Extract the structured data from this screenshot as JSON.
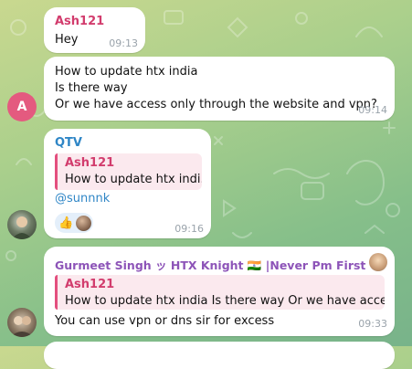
{
  "messages": [
    {
      "sender": "Ash121",
      "sender_color": "#d23c6d",
      "text": "Hey",
      "time": "09:13"
    },
    {
      "lines": [
        "How to update htx india",
        "Is there way",
        "Or we have access only through the website and vpn?"
      ],
      "time": "09:14",
      "avatar_letter": "A",
      "avatar_color": "#e45a7f"
    },
    {
      "sender": "QTV",
      "sender_color": "#2f86c6",
      "reply_name": "Ash121",
      "reply_text": "How to update htx indi...",
      "mention": "@sunnnk",
      "reaction_emoji": "👍",
      "time": "09:16"
    },
    {
      "sender": "Gurmeet Singh ッ HTX Knight 🇮🇳 |Never Pm First",
      "sender_color": "#8d54b8",
      "reply_name": "Ash121",
      "reply_text": "How to update htx india Is there way  Or we have acces...",
      "text": "You can use vpn or dns sir for excess",
      "time": "09:33"
    }
  ],
  "colors": {
    "reply_accent": "#e34f7e",
    "mention": "#2f86c6"
  }
}
